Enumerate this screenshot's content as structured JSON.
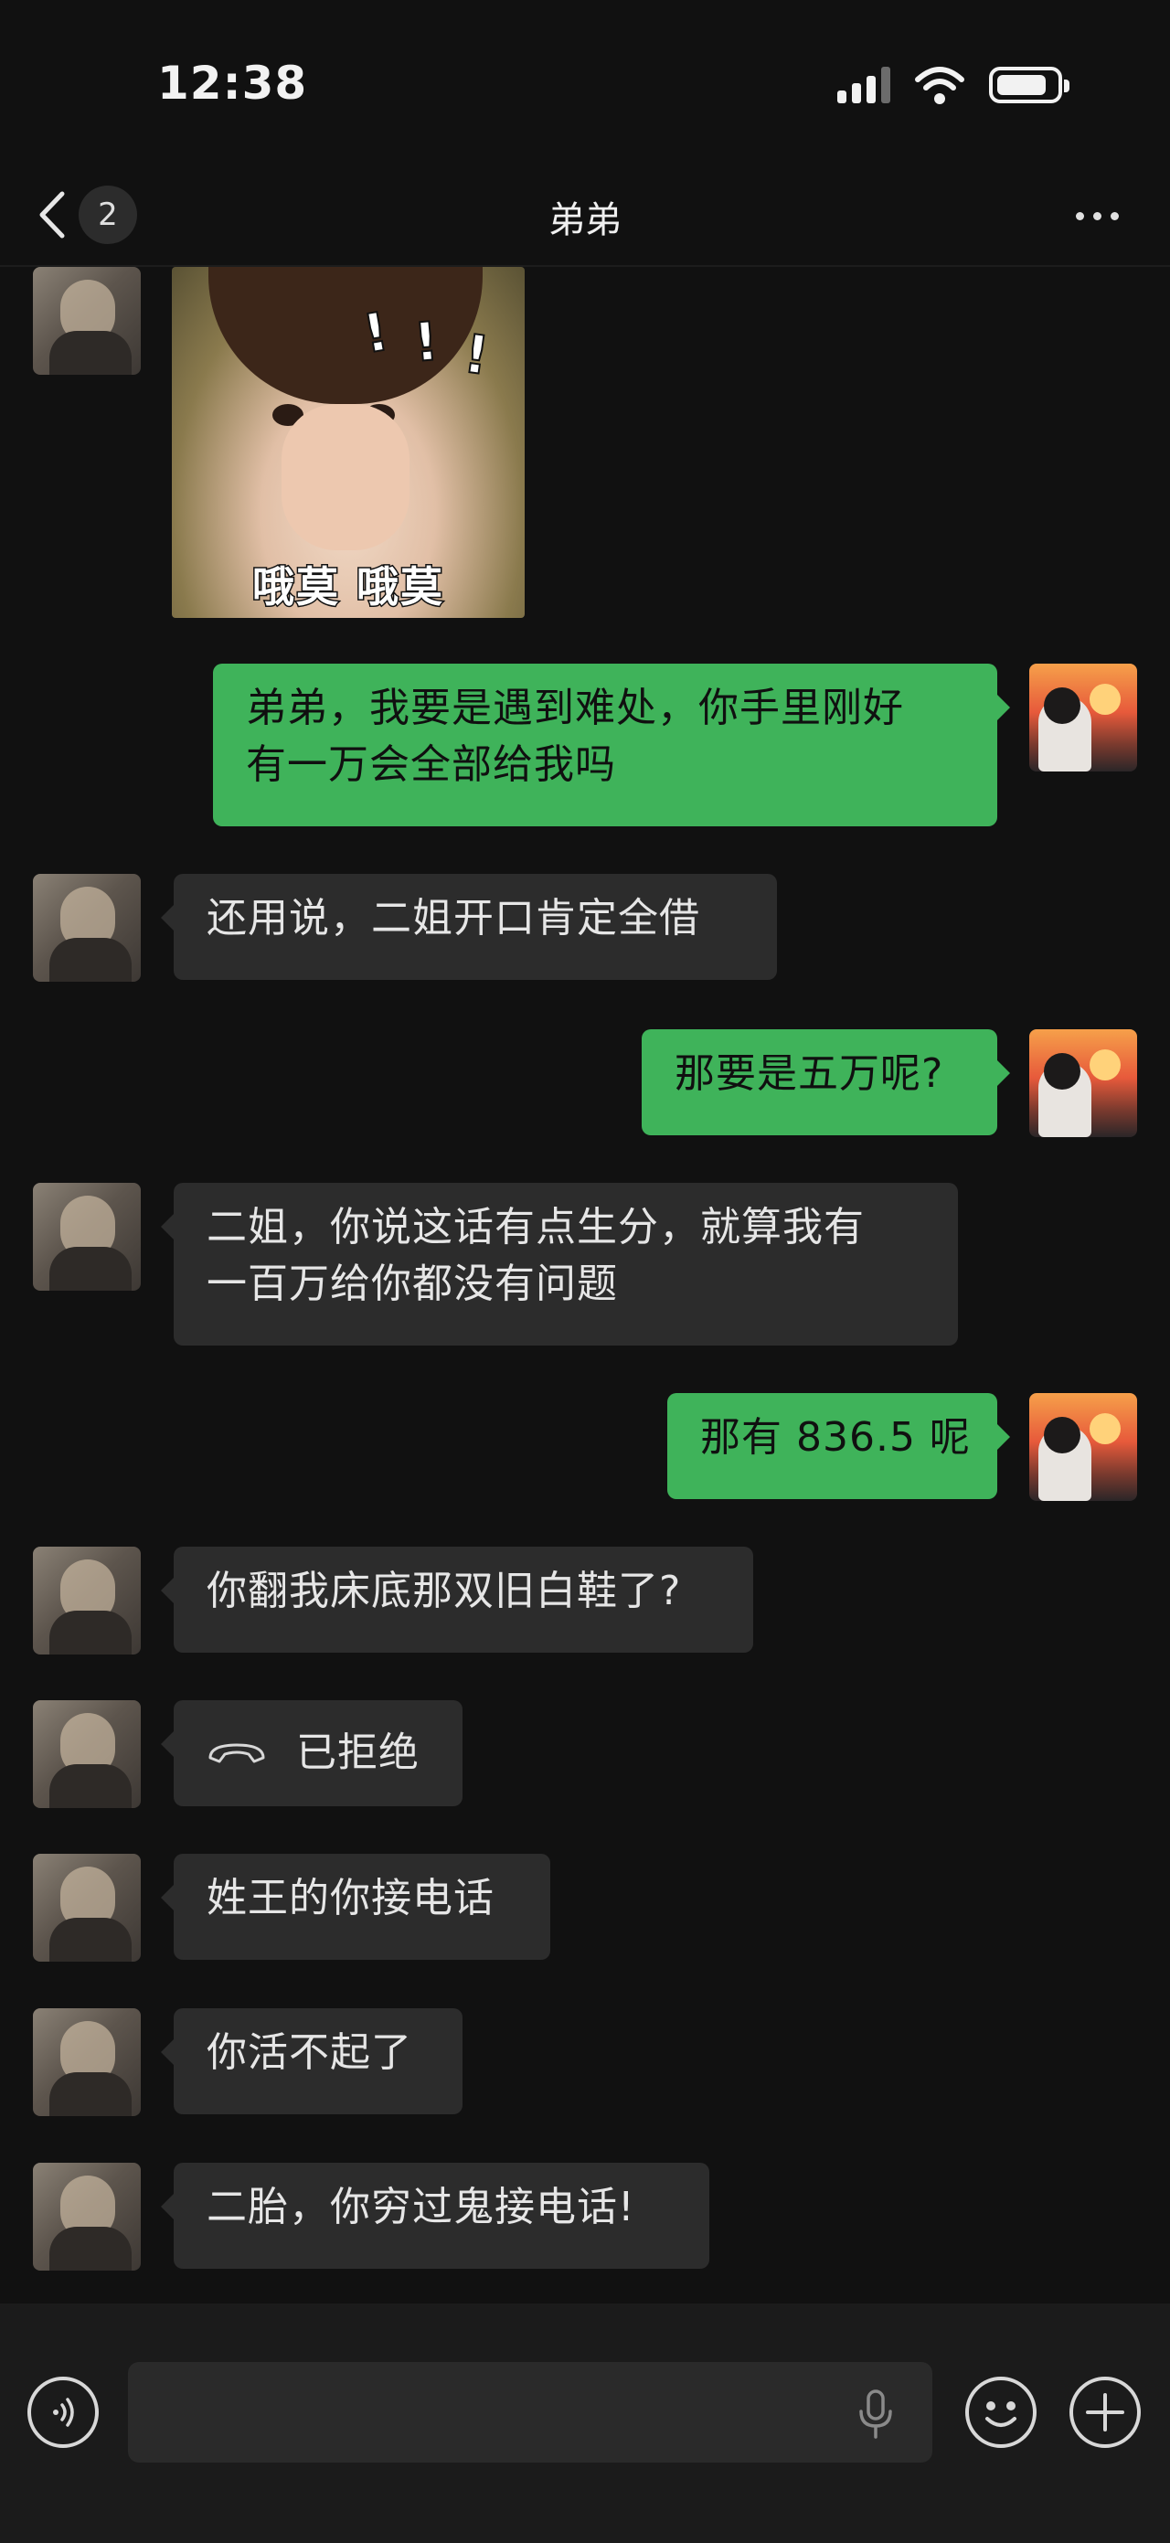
{
  "status": {
    "time": "12:38"
  },
  "header": {
    "back_count": "2",
    "title": "弟弟"
  },
  "sticker": {
    "caption": "哦莫  哦莫",
    "marks": [
      "!",
      "!",
      "!"
    ]
  },
  "messages": [
    {
      "side": "right",
      "text": "弟弟，我要是遇到难处，你手里刚好\n有一万会全部给我吗"
    },
    {
      "side": "left",
      "text": "还用说，二姐开口肯定全借"
    },
    {
      "side": "right",
      "text": "那要是五万呢?"
    },
    {
      "side": "left",
      "text": "二姐，你说这话有点生分，就算我有\n一百万给你都没有问题"
    },
    {
      "side": "right",
      "text": "那有 836.5 呢"
    },
    {
      "side": "left",
      "text": "你翻我床底那双旧白鞋了?"
    },
    {
      "side": "left",
      "text": "已拒绝",
      "type": "call-rejected"
    },
    {
      "side": "left",
      "text": "姓王的你接电话"
    },
    {
      "side": "left",
      "text": "你活不起了"
    },
    {
      "side": "left",
      "text": "二胎，你穷过鬼接电话!"
    }
  ],
  "input": {
    "value": "",
    "placeholder": ""
  },
  "colors": {
    "background": "#111111",
    "bubble_left": "#2c2c2c",
    "bubble_right": "#3fb35a",
    "input_bar": "#1b1b1b"
  },
  "icons": [
    "chevron-left-icon",
    "more-icon",
    "signal-icon",
    "wifi-icon",
    "battery-icon",
    "phone-hangup-icon",
    "voice-icon",
    "microphone-icon",
    "emoji-icon",
    "plus-icon"
  ]
}
